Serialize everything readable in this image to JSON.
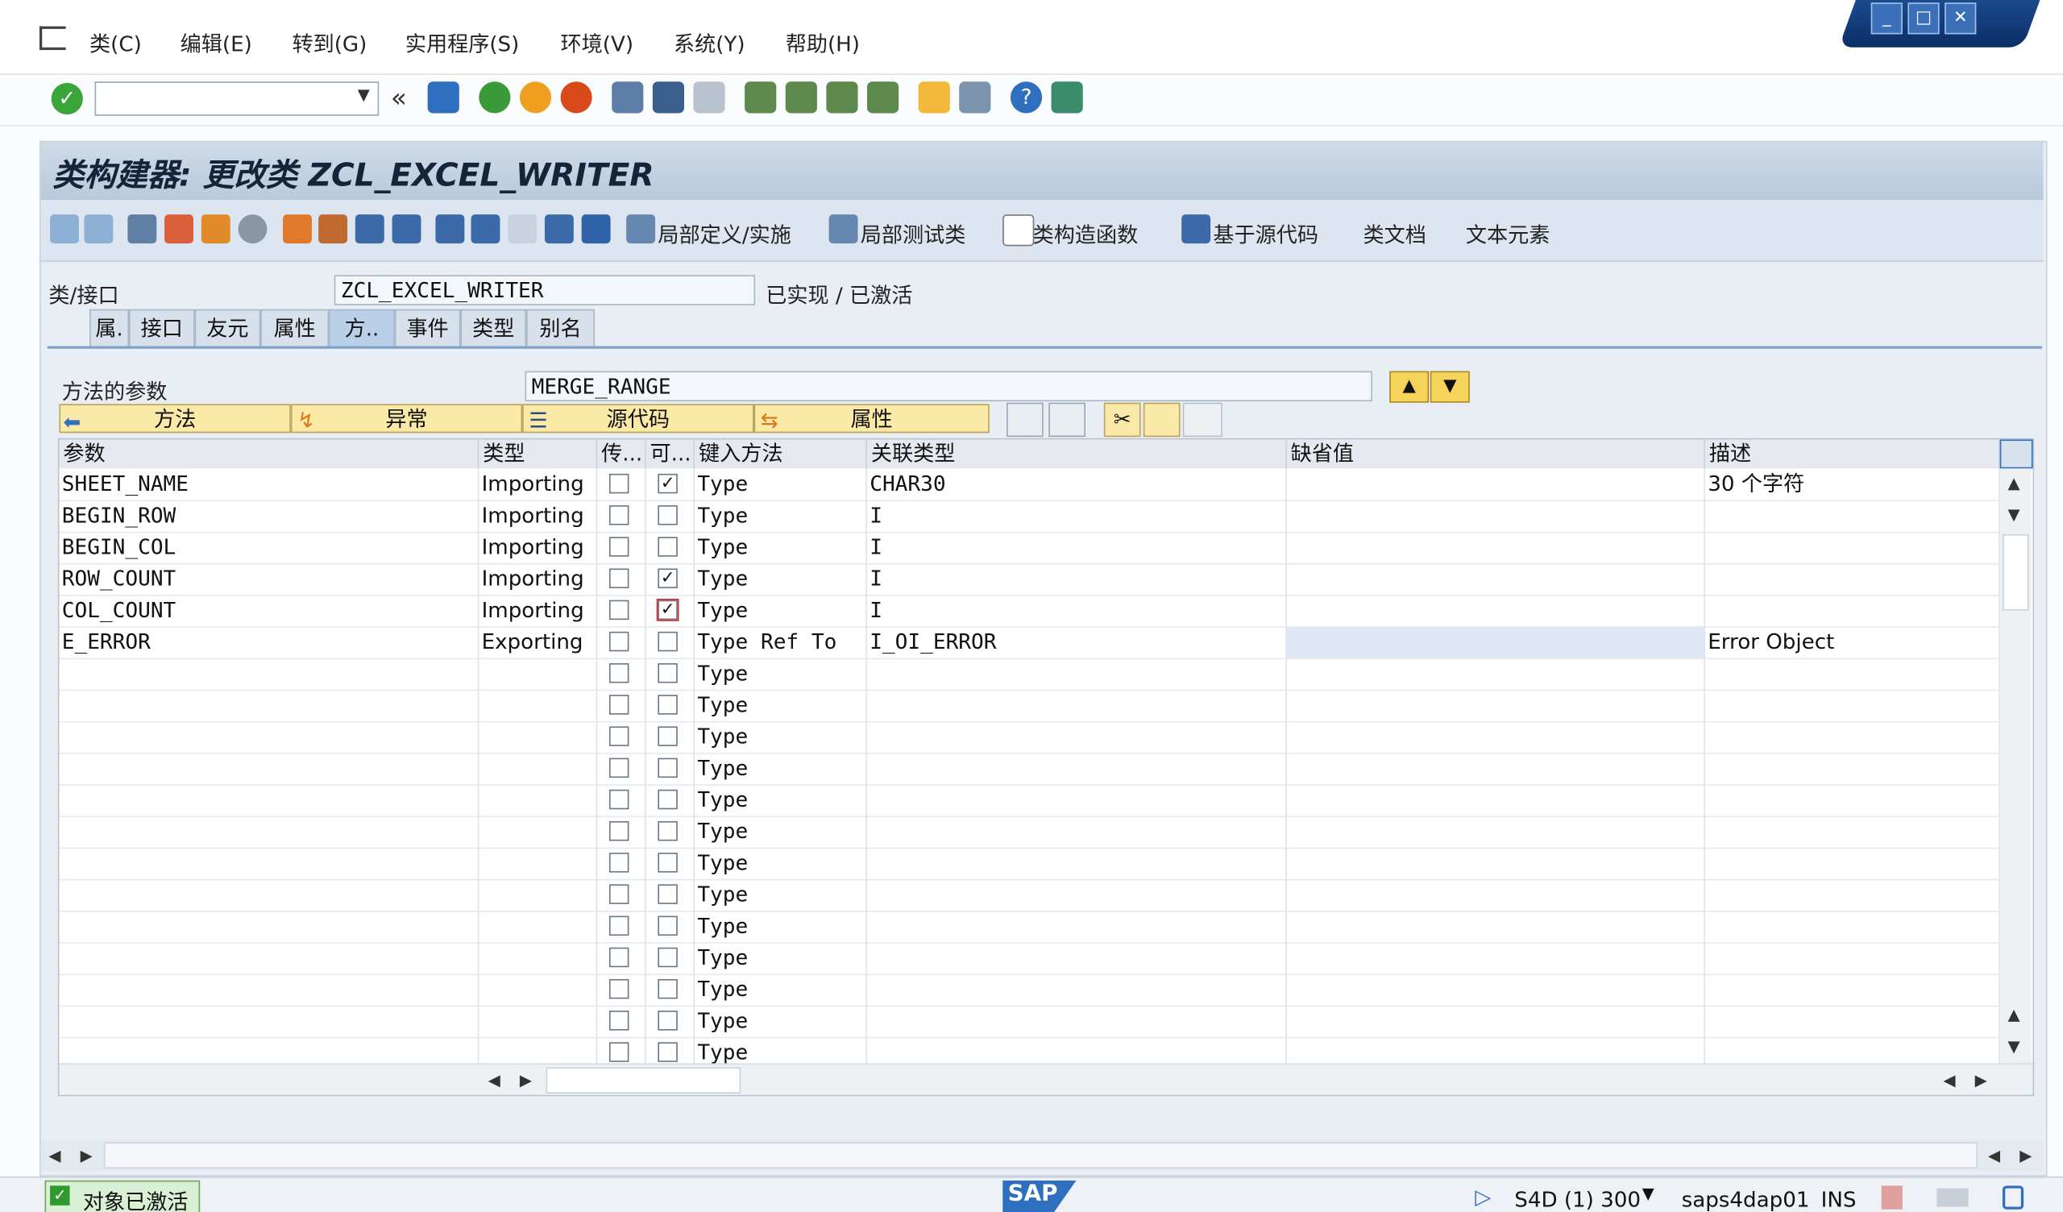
{
  "menu": {
    "items": [
      "类(C)",
      "编辑(E)",
      "转到(G)",
      "实用程序(S)",
      "环境(V)",
      "系统(Y)",
      "帮助(H)"
    ]
  },
  "toolbar": {
    "command_field_value": "",
    "collapse_symbol": "«"
  },
  "window": {
    "minimize": "_",
    "maximize": "□",
    "close": "✕"
  },
  "title": "类构建器: 更改类 ZCL_EXCEL_WRITER",
  "app_toolbar": {
    "labels": [
      "局部定义/实施",
      "局部测试类",
      "类构造函数",
      "基于源代码",
      "类文档",
      "文本元素"
    ]
  },
  "class_info": {
    "label": "类/接口",
    "value": "ZCL_EXCEL_WRITER",
    "status": "已实现 / 已激活"
  },
  "tabs": [
    "属.",
    "接口",
    "友元",
    "属性",
    "方..",
    "事件",
    "类型",
    "别名"
  ],
  "method_params": {
    "label": "方法的参数",
    "method_name": "MERGE_RANGE",
    "subtabs": [
      "方法",
      "异常",
      "源代码",
      "属性"
    ]
  },
  "grid": {
    "headers": [
      "参数",
      "类型",
      "传...",
      "可...",
      "键入方法",
      "关联类型",
      "缺省值",
      "描述"
    ],
    "rows": [
      {
        "param": "SHEET_NAME",
        "type": "Importing",
        "pass": false,
        "opt": true,
        "typing": "Type",
        "assoc": "CHAR30",
        "default": "",
        "desc": "30 个字符"
      },
      {
        "param": "BEGIN_ROW",
        "type": "Importing",
        "pass": false,
        "opt": false,
        "typing": "Type",
        "assoc": "I",
        "default": "",
        "desc": ""
      },
      {
        "param": "BEGIN_COL",
        "type": "Importing",
        "pass": false,
        "opt": false,
        "typing": "Type",
        "assoc": "I",
        "default": "",
        "desc": ""
      },
      {
        "param": "ROW_COUNT",
        "type": "Importing",
        "pass": false,
        "opt": true,
        "typing": "Type",
        "assoc": "I",
        "default": "",
        "desc": ""
      },
      {
        "param": "COL_COUNT",
        "type": "Importing",
        "pass": false,
        "opt": true,
        "typing": "Type",
        "assoc": "I",
        "default": "",
        "desc": ""
      },
      {
        "param": "E_ERROR",
        "type": "Exporting",
        "pass": false,
        "opt": false,
        "typing": "Type Ref To",
        "assoc": "I_OI_ERROR",
        "default": "",
        "desc": "Error Object"
      }
    ],
    "empty_typing": "Type",
    "empty_row_count": 13
  },
  "status": {
    "message": "对象已激活",
    "logo": "SAP",
    "system": "S4D (1) 300",
    "server": "saps4dap01",
    "mode": "INS"
  }
}
